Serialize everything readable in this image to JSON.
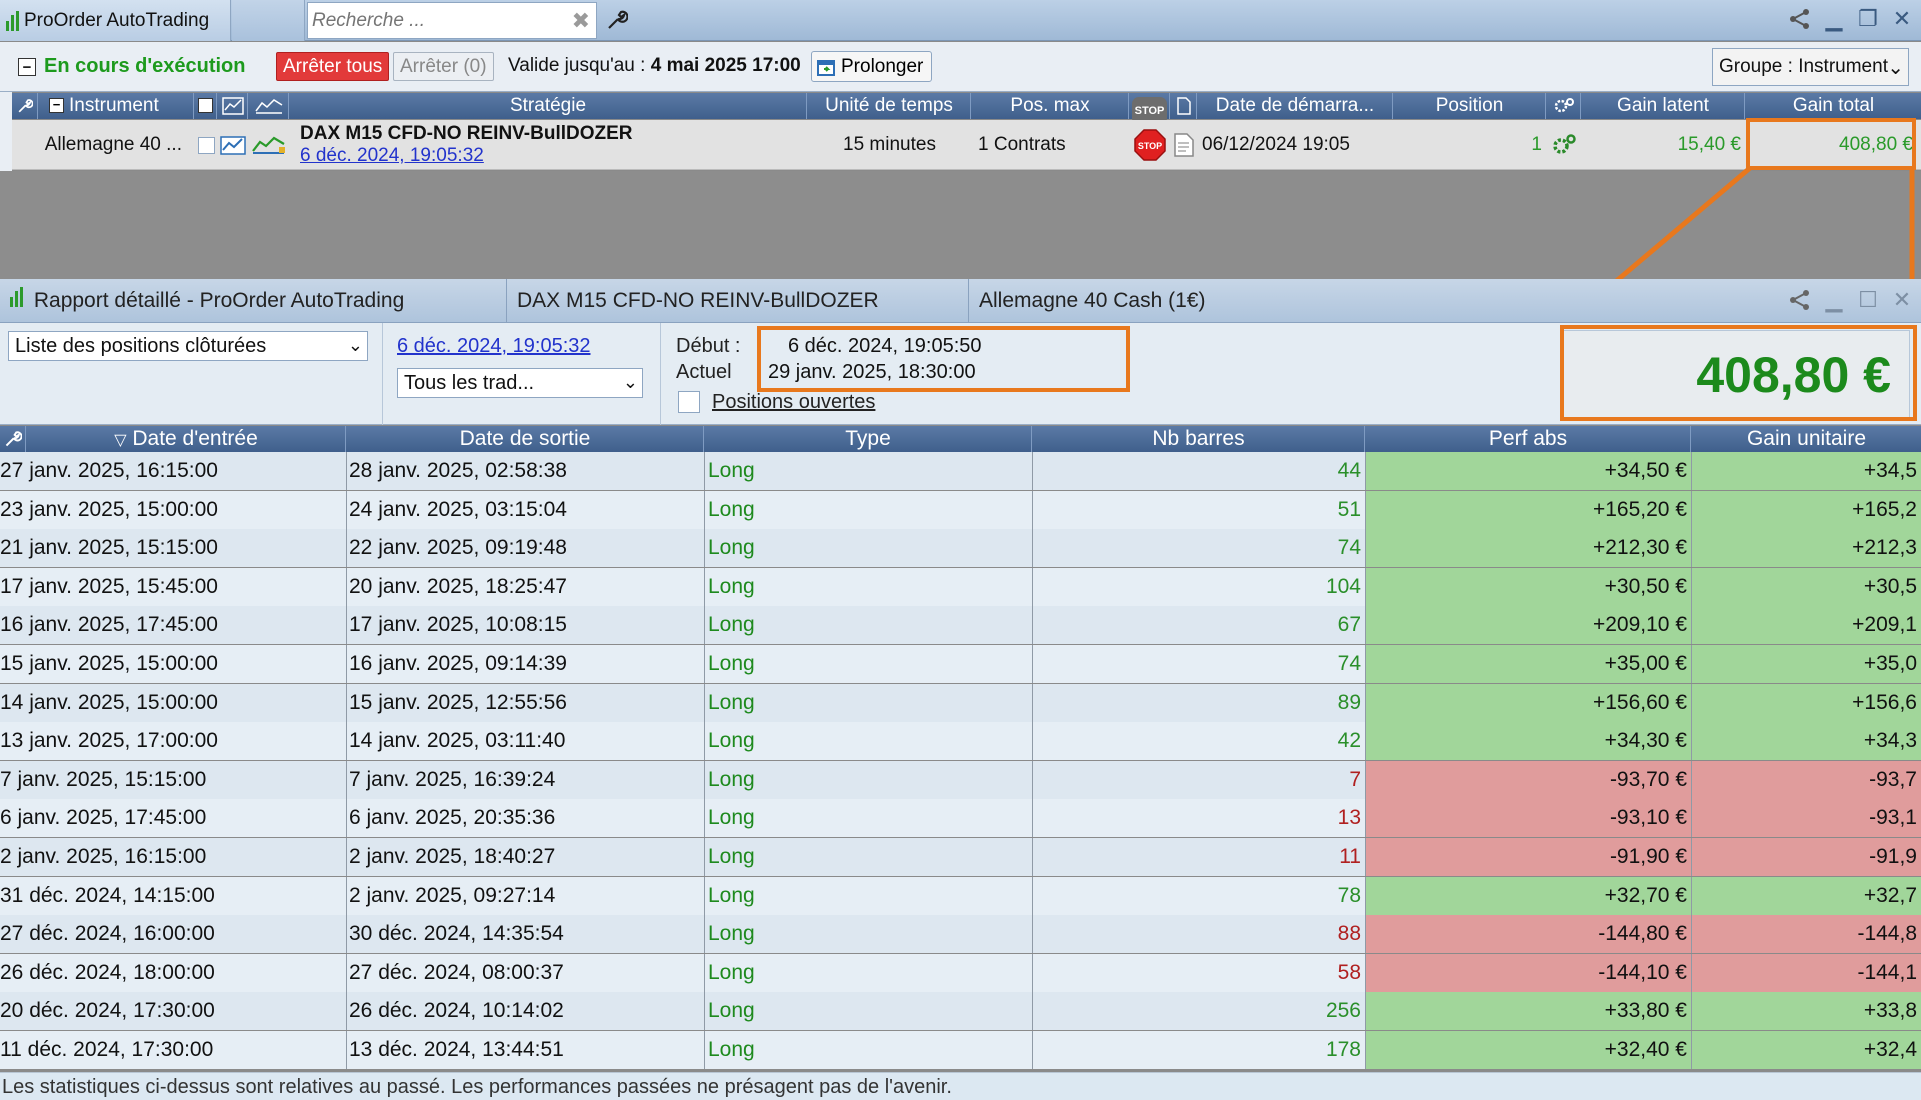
{
  "app": {
    "tab_title": "ProOrder AutoTrading",
    "search_placeholder": "Recherche ..."
  },
  "toolbar": {
    "running_label": "En cours d'exécution",
    "stop_all": "Arrêter tous",
    "stop_count": "Arrêter (0)",
    "valid_prefix": "Valide jusqu'au : ",
    "valid_date": "4 mai 2025 17:00",
    "prolong": "Prolonger",
    "group": "Groupe : Instrument"
  },
  "strategy_table": {
    "headers": {
      "instrument": "Instrument",
      "strategy": "Stratégie",
      "timeframe": "Unité de temps",
      "pos_max": "Pos. max",
      "start_date": "Date de démarra...",
      "position": "Position",
      "latent_gain": "Gain latent",
      "total_gain": "Gain total"
    },
    "row": {
      "instrument": "Allemagne 40 ...",
      "strategy_name": "DAX M15 CFD-NO REINV-BullDOZER",
      "strategy_date": "6 déc. 2024, 19:05:32",
      "timeframe": "15 minutes",
      "pos_max": "1 Contrats",
      "stop_label": "STOP",
      "start_date": "06/12/2024 19:05",
      "position": "1",
      "latent_gain": "15,40 €",
      "total_gain": "408,80 €"
    }
  },
  "report": {
    "title": "Rapport détaillé - ProOrder AutoTrading",
    "strategy": "DAX M15 CFD-NO REINV-BullDOZER",
    "instrument": "Allemagne 40 Cash (1€)",
    "list_select": "Liste des positions clôturées",
    "date_link": "6 déc. 2024, 19:05:32",
    "trades_select": "Tous les trad...",
    "start_label": "Début :",
    "current_label": "Actuel",
    "start_value": "6 déc. 2024, 19:05:50",
    "current_value": "29 janv. 2025, 18:30:00",
    "open_positions": "Positions ouvertes",
    "total": "408,80 €",
    "headers": {
      "entry": "Date d'entrée",
      "exit": "Date de sortie",
      "type": "Type",
      "bars": "Nb barres",
      "perf": "Perf abs",
      "unit": "Gain unitaire"
    },
    "rows": [
      {
        "entry": "27 janv. 2025, 16:15:00",
        "exit": "28 janv. 2025, 02:58:38",
        "type": "Long",
        "bars": "44",
        "perf": "+34,50 €",
        "unit": "+34,5",
        "win": true
      },
      {
        "entry": "23 janv. 2025, 15:00:00",
        "exit": "24 janv. 2025, 03:15:04",
        "type": "Long",
        "bars": "51",
        "perf": "+165,20 €",
        "unit": "+165,2",
        "win": true
      },
      {
        "entry": "21 janv. 2025, 15:15:00",
        "exit": "22 janv. 2025, 09:19:48",
        "type": "Long",
        "bars": "74",
        "perf": "+212,30 €",
        "unit": "+212,3",
        "win": true
      },
      {
        "entry": "17 janv. 2025, 15:45:00",
        "exit": "20 janv. 2025, 18:25:47",
        "type": "Long",
        "bars": "104",
        "perf": "+30,50 €",
        "unit": "+30,5",
        "win": true
      },
      {
        "entry": "16 janv. 2025, 17:45:00",
        "exit": "17 janv. 2025, 10:08:15",
        "type": "Long",
        "bars": "67",
        "perf": "+209,10 €",
        "unit": "+209,1",
        "win": true
      },
      {
        "entry": "15 janv. 2025, 15:00:00",
        "exit": "16 janv. 2025, 09:14:39",
        "type": "Long",
        "bars": "74",
        "perf": "+35,00 €",
        "unit": "+35,0",
        "win": true
      },
      {
        "entry": "14 janv. 2025, 15:00:00",
        "exit": "15 janv. 2025, 12:55:56",
        "type": "Long",
        "bars": "89",
        "perf": "+156,60 €",
        "unit": "+156,6",
        "win": true
      },
      {
        "entry": "13 janv. 2025, 17:00:00",
        "exit": "14 janv. 2025, 03:11:40",
        "type": "Long",
        "bars": "42",
        "perf": "+34,30 €",
        "unit": "+34,3",
        "win": true
      },
      {
        "entry": "7 janv. 2025, 15:15:00",
        "exit": "7 janv. 2025, 16:39:24",
        "type": "Long",
        "bars": "7",
        "perf": "-93,70 €",
        "unit": "-93,7",
        "win": false
      },
      {
        "entry": "6 janv. 2025, 17:45:00",
        "exit": "6 janv. 2025, 20:35:36",
        "type": "Long",
        "bars": "13",
        "perf": "-93,10 €",
        "unit": "-93,1",
        "win": false
      },
      {
        "entry": "2 janv. 2025, 16:15:00",
        "exit": "2 janv. 2025, 18:40:27",
        "type": "Long",
        "bars": "11",
        "perf": "-91,90 €",
        "unit": "-91,9",
        "win": false
      },
      {
        "entry": "31 déc. 2024, 14:15:00",
        "exit": "2 janv. 2025, 09:27:14",
        "type": "Long",
        "bars": "78",
        "perf": "+32,70 €",
        "unit": "+32,7",
        "win": true
      },
      {
        "entry": "27 déc. 2024, 16:00:00",
        "exit": "30 déc. 2024, 14:35:54",
        "type": "Long",
        "bars": "88",
        "perf": "-144,80 €",
        "unit": "-144,8",
        "win": false
      },
      {
        "entry": "26 déc. 2024, 18:00:00",
        "exit": "27 déc. 2024, 08:00:37",
        "type": "Long",
        "bars": "58",
        "perf": "-144,10 €",
        "unit": "-144,1",
        "win": false
      },
      {
        "entry": "20 déc. 2024, 17:30:00",
        "exit": "26 déc. 2024, 10:14:02",
        "type": "Long",
        "bars": "256",
        "perf": "+33,80 €",
        "unit": "+33,8",
        "win": true
      },
      {
        "entry": "11 déc. 2024, 17:30:00",
        "exit": "13 déc. 2024, 13:44:51",
        "type": "Long",
        "bars": "178",
        "perf": "+32,40 €",
        "unit": "+32,4",
        "win": true
      }
    ],
    "disclaimer": "Les statistiques ci-dessus sont relatives au passé. Les performances passées ne présagent pas de l'avenir."
  },
  "colors": {
    "win_bg": "#a1d69a",
    "loss_bg": "#e09c9c",
    "row_even": "#dde7f0",
    "row_odd": "#e6eef5",
    "win_text": "#2a8f2a",
    "loss_text": "#b02020",
    "highlight": "#e8781d"
  }
}
